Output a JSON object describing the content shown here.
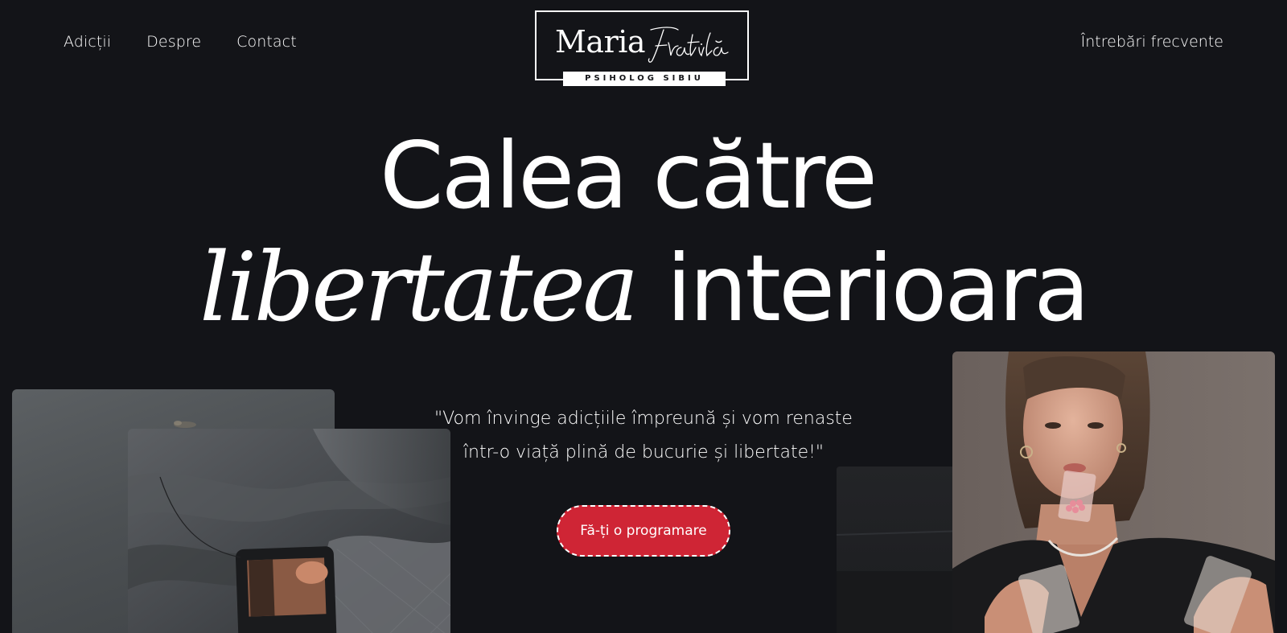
{
  "nav": {
    "left_items": [
      {
        "label": "Adicții"
      },
      {
        "label": "Despre"
      },
      {
        "label": "Contact"
      }
    ],
    "right_item": {
      "label": "Întrebări frecvente"
    }
  },
  "logo": {
    "name": "Maria",
    "script": "Frățilă",
    "tagline": "PSIHOLOG SIBIU"
  },
  "hero": {
    "line1": "Calea către",
    "line2_italic": "libertatea",
    "line2_regular": "interioara",
    "quote_line1": "\"Vom învinge adicțiile împreună și vom renaste",
    "quote_line2": "într-o viață plină de bucurie și libertate!\"",
    "cta_label": "Fă-ți o programare"
  },
  "colors": {
    "background": "#131418",
    "accent": "#cf2535",
    "text": "#ffffff"
  },
  "images": [
    {
      "name": "gray-backdrop-photo"
    },
    {
      "name": "bed-with-tablet-photo"
    },
    {
      "name": "dark-room-photo"
    },
    {
      "name": "woman-with-pills-photo"
    }
  ]
}
